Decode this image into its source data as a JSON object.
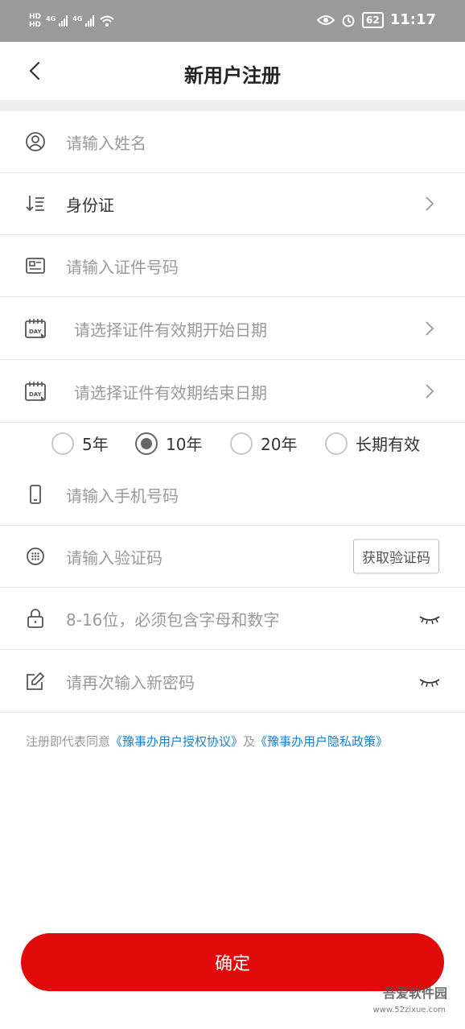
{
  "status_bar": {
    "hd1": "HD",
    "hd2": "HD",
    "net1": "4G",
    "net2": "4G",
    "battery": "62",
    "time": "11:17"
  },
  "header": {
    "title": "新用户注册"
  },
  "form": {
    "name_placeholder": "请输入姓名",
    "id_type_value": "身份证",
    "id_number_placeholder": "请输入证件号码",
    "start_date_placeholder": "请选择证件有效期开始日期",
    "end_date_placeholder": "请选择证件有效期结束日期",
    "validity_options": [
      {
        "label": "5年",
        "selected": false
      },
      {
        "label": "10年",
        "selected": true
      },
      {
        "label": "20年",
        "selected": false
      },
      {
        "label": "长期有效",
        "selected": false
      }
    ],
    "phone_placeholder": "请输入手机号码",
    "code_placeholder": "请输入验证码",
    "get_code_label": "获取验证码",
    "password_placeholder": "8-16位，必须包含字母和数字",
    "confirm_password_placeholder": "请再次输入新密码"
  },
  "agreement": {
    "prefix": "注册即代表同意",
    "user_agreement": "《豫事办用户授权协议》",
    "and": "及",
    "privacy_policy": "《豫事办用户隐私政策》"
  },
  "confirm_label": "确定",
  "watermark": {
    "name": "吾爱软件园",
    "url": "www.52zixue.com"
  },
  "colors": {
    "primary": "#e10a0a",
    "link": "#1a7fd0",
    "placeholder": "#9a9a9a"
  }
}
